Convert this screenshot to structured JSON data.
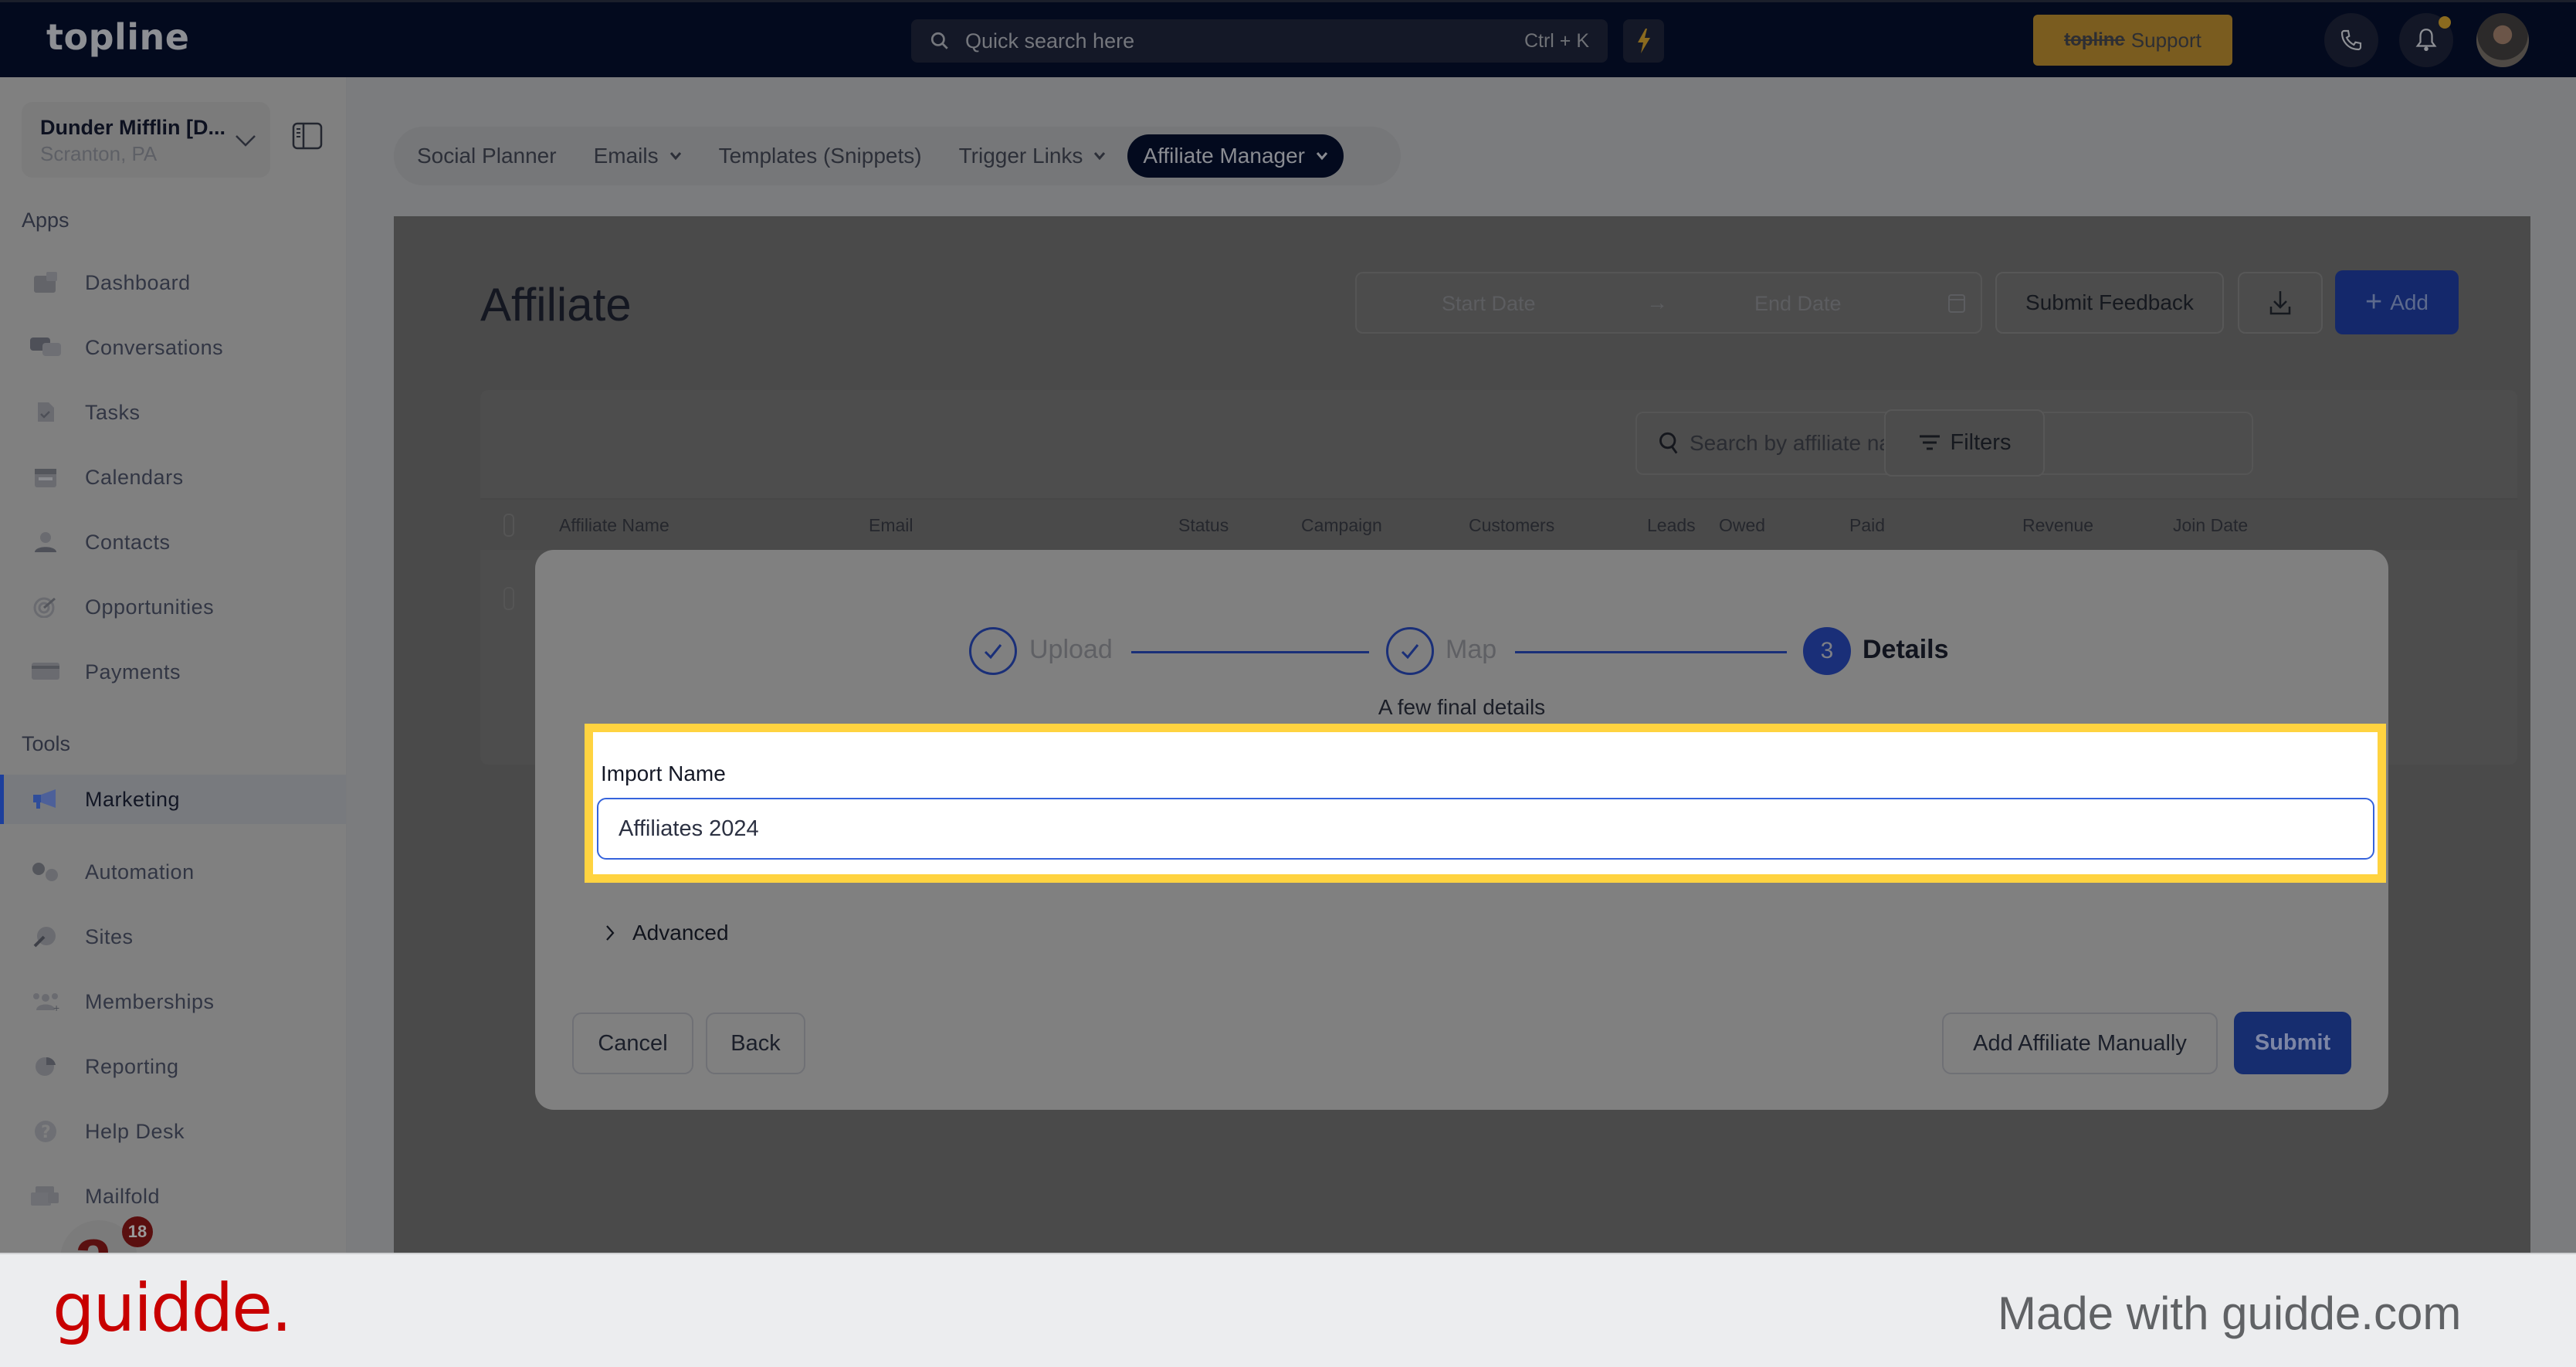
{
  "topbar": {
    "logo": "topline",
    "search_placeholder": "Quick search here",
    "search_shortcut": "Ctrl + K",
    "support_brand": "topline",
    "support_label": "Support",
    "notification_dot_color": "#8a6a1f"
  },
  "sidebar": {
    "location_name": "Dunder Mifflin [D...",
    "location_sub": "Scranton, PA",
    "apps_label": "Apps",
    "tools_label": "Tools",
    "apps": [
      {
        "label": "Dashboard",
        "icon": "dashboard-icon"
      },
      {
        "label": "Conversations",
        "icon": "chat-icon"
      },
      {
        "label": "Tasks",
        "icon": "task-icon"
      },
      {
        "label": "Calendars",
        "icon": "calendar-icon"
      },
      {
        "label": "Contacts",
        "icon": "user-icon"
      },
      {
        "label": "Opportunities",
        "icon": "target-icon"
      },
      {
        "label": "Payments",
        "icon": "credit-card-icon"
      }
    ],
    "tools": [
      {
        "label": "Marketing",
        "icon": "megaphone-icon",
        "active": true
      },
      {
        "label": "Automation",
        "icon": "gears-icon"
      },
      {
        "label": "Sites",
        "icon": "globe-icon"
      },
      {
        "label": "Memberships",
        "icon": "users-plus-icon"
      },
      {
        "label": "Reporting",
        "icon": "pie-chart-icon"
      },
      {
        "label": "Help Desk",
        "icon": "question-icon"
      },
      {
        "label": "Mailfold",
        "icon": "mailbox-icon"
      }
    ],
    "widget_badge": "18"
  },
  "tabs": [
    {
      "label": "Social Planner",
      "dropdown": false
    },
    {
      "label": "Emails",
      "dropdown": true
    },
    {
      "label": "Templates (Snippets)",
      "dropdown": false
    },
    {
      "label": "Trigger Links",
      "dropdown": true
    },
    {
      "label": "Affiliate Manager",
      "dropdown": true,
      "active": true
    }
  ],
  "page": {
    "title": "Affiliate",
    "start_date_placeholder": "Start Date",
    "end_date_placeholder": "End Date",
    "date_arrow": "→",
    "feedback_label": "Submit Feedback",
    "add_label": "Add",
    "search_placeholder": "Search by affiliate name and email",
    "filters_label": "Filters",
    "columns": [
      "Affiliate Name",
      "Email",
      "Status",
      "Campaign",
      "Customers",
      "Leads",
      "Owed",
      "Paid",
      "Revenue",
      "Join Date"
    ]
  },
  "modal": {
    "steps": [
      {
        "label": "Upload",
        "state": "done"
      },
      {
        "label": "Map",
        "state": "done"
      },
      {
        "label": "Details",
        "state": "current",
        "number": "3"
      }
    ],
    "subtitle": "A few final details",
    "import_name_label": "Import Name",
    "import_name_value": "Affiliates 2024",
    "advanced_label": "Advanced",
    "cancel_label": "Cancel",
    "back_label": "Back",
    "add_manual_label": "Add Affiliate Manually",
    "submit_label": "Submit"
  },
  "footer": {
    "logo": "guidde.",
    "made_with": "Made with guidde.com"
  },
  "colors": {
    "highlight": "#ffd340",
    "primary": "#1a2f78",
    "focus_border": "#3563dc",
    "guidde_red": "#c80000"
  }
}
